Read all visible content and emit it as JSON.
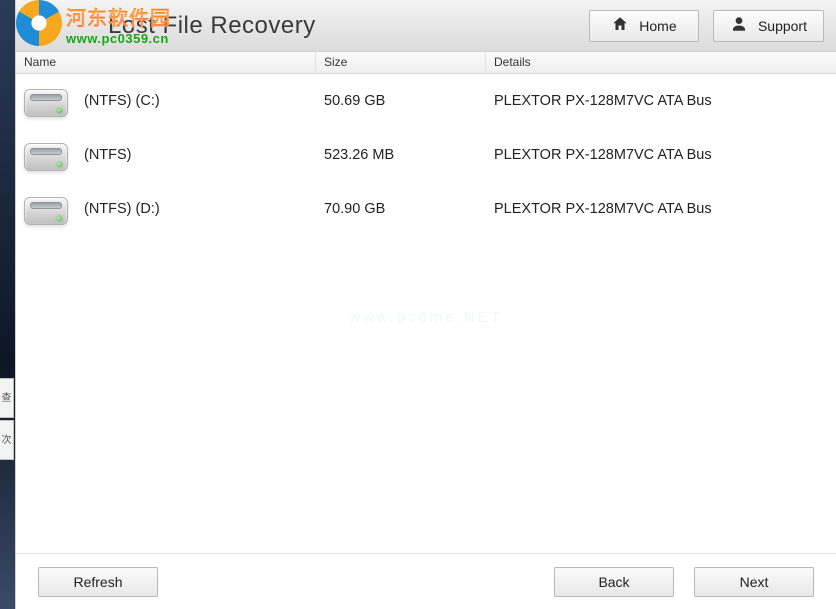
{
  "watermark": {
    "site_name_cn": "河东软件园",
    "site_url": "www.pc0359.cn",
    "faint_text": "www.pc6me.NET"
  },
  "header": {
    "title": "Lost File Recovery",
    "home_label": "Home",
    "support_label": "Support"
  },
  "columns": {
    "name": "Name",
    "size": "Size",
    "details": "Details"
  },
  "drives": [
    {
      "name": "(NTFS) (C:)",
      "size": "50.69 GB",
      "details": "PLEXTOR PX-128M7VC  ATA Bus"
    },
    {
      "name": "(NTFS)",
      "size": "523.26 MB",
      "details": "PLEXTOR PX-128M7VC  ATA Bus"
    },
    {
      "name": "(NTFS) (D:)",
      "size": "70.90 GB",
      "details": "PLEXTOR PX-128M7VC  ATA Bus"
    }
  ],
  "footer": {
    "refresh_label": "Refresh",
    "back_label": "Back",
    "next_label": "Next"
  },
  "left_tabs": [
    "查",
    "次"
  ]
}
